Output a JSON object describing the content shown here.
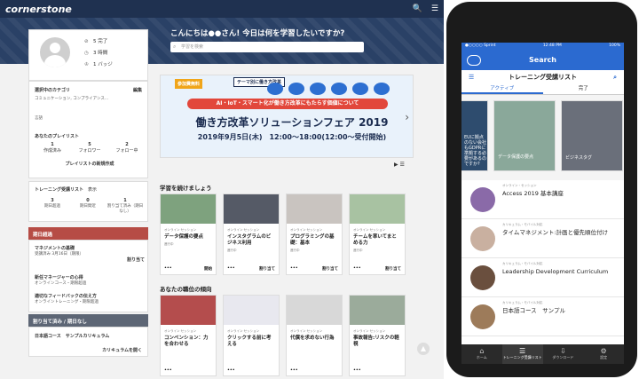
{
  "desktop": {
    "logo": "cornerstone",
    "greeting": "こんにちは●●さん! 今日は何を学習したいですか?",
    "search_placeholder": "学習を検索",
    "profile": {
      "stats": [
        {
          "icon": "check-icon",
          "glyph": "⊘",
          "value": "5",
          "label": "完了"
        },
        {
          "icon": "clock-icon",
          "glyph": "◷",
          "value": "3",
          "label": "時間"
        },
        {
          "icon": "badge-icon",
          "glyph": "♔",
          "value": "1",
          "label": "バッジ"
        }
      ]
    },
    "categories": {
      "title": "選択中のカテゴリ",
      "edit": "編集",
      "value": "コミュニケーション, コンプライアンス...",
      "lang": "言語"
    },
    "playlists": {
      "title": "あなたのプレイリスト",
      "items": [
        {
          "num": "1",
          "label": "作成済み"
        },
        {
          "num": "5",
          "label": "フォロワー"
        },
        {
          "num": "2",
          "label": "フォロー中"
        }
      ],
      "new_btn": "プレイリストの新規作成"
    },
    "training": {
      "title": "トレーニング受講リスト",
      "show": "表示",
      "items": [
        {
          "num": "3",
          "label": "期日超過"
        },
        {
          "num": "0",
          "label": "期日間近"
        },
        {
          "num": "1",
          "label": "割り当て済み（期日なし）"
        }
      ]
    },
    "overdue": {
      "header": "期日超過",
      "items": [
        {
          "title": "マネジメントの基礎",
          "sub": "受講済み 3月16日（期限）",
          "action": "割り当て"
        },
        {
          "title": "新任マネージャーの心得",
          "sub": "オンラインコース・期限超過",
          "action": ""
        },
        {
          "title": "適切なフィードバックの伝え方",
          "sub": "オンライントレーニング・期限超過",
          "action": ""
        }
      ]
    },
    "assigned": {
      "header": "割り当て済み / 期日なし",
      "title": "日本語コース　サンプルカリキュラム",
      "action": "カリキュラムを開く"
    },
    "banner": {
      "tag": "参加費無料",
      "tag2": "テーマ別に働き方改革",
      "pill": "AI・IoT・スマート化が働き方改革にもたらす価値について",
      "title": "働き方改革ソリューションフェア 2019",
      "date": "2019年9月5日(木)　12:00～18:00(12:00～受付開始)"
    },
    "continue_title": "学習を続けましょう",
    "continue_tiles": [
      {
        "type": "オンライン セッション",
        "title": "データ保護の要点",
        "status": "進行中",
        "action": "開始",
        "color": "#7ea27e"
      },
      {
        "type": "オンライン セッション",
        "title": "インスタグラムのビジネス利用",
        "status": "進行中",
        "action": "割り当て",
        "color": "#555a66"
      },
      {
        "type": "オンライン セッション",
        "title": "プログラミングの基礎：基本",
        "status": "進行中",
        "action": "割り当て",
        "color": "#c9c4c0"
      },
      {
        "type": "オンライン セッション",
        "title": "チームを率いてまとめる力",
        "status": "進行中",
        "action": "割り当て",
        "color": "#a8c2a2"
      }
    ],
    "role_title": "あなたの職位の傾向",
    "role_tiles": [
      {
        "type": "オンライン セッション",
        "title": "コンベンション：力を合わせる",
        "color": "#b44d4d"
      },
      {
        "type": "オンライン セッション",
        "title": "クリックする前に考える",
        "color": "#e8e8ef"
      },
      {
        "type": "オンライン セッション",
        "title": "代償を求めない行為",
        "color": "#d8d8d8"
      },
      {
        "type": "オンライン セッション",
        "title": "事故報告:リスクの軽視",
        "color": "#9bab9b"
      }
    ]
  },
  "mobile": {
    "status": {
      "carrier": "●○○○○ Sprint",
      "time": "12:48 PM",
      "battery": "100%"
    },
    "header": "Search",
    "title": "トレーニング受講リスト",
    "tabs": [
      "アクティブ",
      "完了"
    ],
    "carousel": [
      {
        "title": "EUに拠点のない会社もGDPRに準拠する必要があるのですか?"
      },
      {
        "title": "データ保護の要点"
      },
      {
        "title": "ビジネスタグ"
      }
    ],
    "list": [
      {
        "meta": "オンライン・セッション",
        "title": "Access 2019 基本講座",
        "color": "#8a6aa8"
      },
      {
        "meta": "カリキュラム・モバイル対応",
        "title": "タイムマネジメント:計画と優先順位付け",
        "color": "#c9b0a0"
      },
      {
        "meta": "カリキュラム・モバイル対応",
        "title": "Leadership Development Curriculum",
        "color": "#6a4f3e"
      },
      {
        "meta": "カリキュラム・モバイル対応",
        "title": "日本語コース　サンプル",
        "color": "#9d7b5a"
      }
    ],
    "tabbar": [
      {
        "icon": "home-icon",
        "glyph": "⌂",
        "label": "ホーム"
      },
      {
        "icon": "list-icon",
        "glyph": "☰",
        "label": "トレーニング受講リスト"
      },
      {
        "icon": "download-icon",
        "glyph": "⇩",
        "label": "ダウンロード"
      },
      {
        "icon": "settings-icon",
        "glyph": "⚙",
        "label": "設定"
      }
    ]
  }
}
